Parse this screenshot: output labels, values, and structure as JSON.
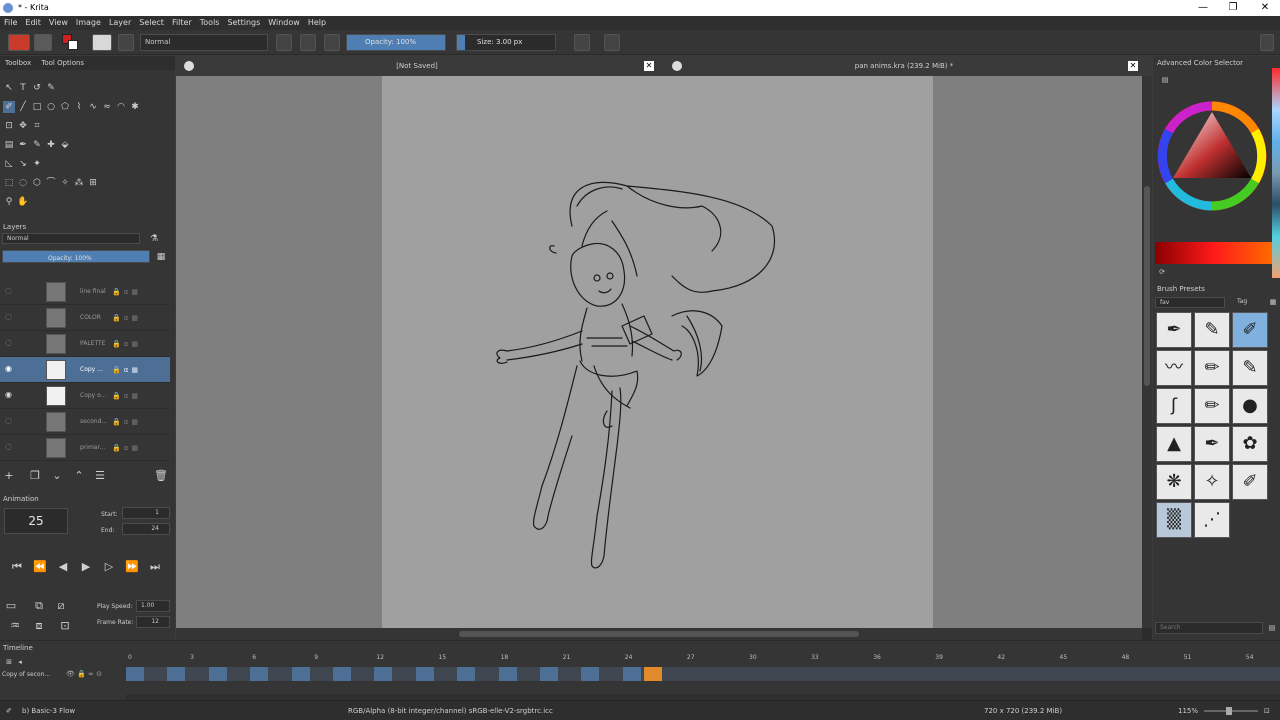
{
  "window": {
    "title": "* - Krita"
  },
  "menu": [
    "File",
    "Edit",
    "View",
    "Image",
    "Layer",
    "Select",
    "Filter",
    "Tools",
    "Settings",
    "Window",
    "Help"
  ],
  "toolbar": {
    "blend_mode": "Normal",
    "opacity_label": "Opacity: 100%",
    "opacity_value": 1.0,
    "size_label": "Size: 3.00 px"
  },
  "left_tabs": [
    "Toolbox",
    "Tool Options"
  ],
  "layers": {
    "title": "Layers",
    "blend_mode": "Normal",
    "opacity_label": "Opacity: 100%",
    "items": [
      {
        "name": "line final",
        "visible": false,
        "selected": false
      },
      {
        "name": "COLOR",
        "visible": false,
        "selected": false
      },
      {
        "name": "PALETTE",
        "visible": false,
        "selected": false
      },
      {
        "name": "Copy ...",
        "visible": true,
        "selected": true
      },
      {
        "name": "Copy o...",
        "visible": true,
        "selected": false
      },
      {
        "name": "second...",
        "visible": false,
        "selected": false
      },
      {
        "name": "primar...",
        "visible": false,
        "selected": false
      }
    ]
  },
  "animation": {
    "title": "Animation",
    "current_frame": "25",
    "start_label": "Start:",
    "start_value": "1",
    "end_label": "End:",
    "end_value": "24",
    "play_speed_label": "Play Speed:",
    "play_speed_value": "1.00",
    "frame_rate_label": "Frame Rate:",
    "frame_rate_value": "12"
  },
  "documents": [
    {
      "label": "[Not Saved]"
    },
    {
      "label": "pan anims.kra (239.2 MiB) *"
    }
  ],
  "right": {
    "color_selector_title": "Advanced Color Selector",
    "brush_presets_title": "Brush Presets",
    "brush_tag": "fav",
    "tag_label": "Tag",
    "search_placeholder": "Search"
  },
  "timeline": {
    "title": "Timeline",
    "layer_name": "Copy of secon...",
    "ticks": [
      "0",
      "3",
      "6",
      "9",
      "12",
      "15",
      "18",
      "21",
      "24",
      "27",
      "30",
      "33",
      "36",
      "39",
      "42",
      "45",
      "48",
      "51",
      "54"
    ],
    "current_frame": 25
  },
  "status": {
    "brush": "b) Basic-3 Flow",
    "colorspace": "RGB/Alpha (8-bit integer/channel)  sRGB-elle-V2-srgbtrc.icc",
    "dims": "720 x 720 (239.2 MiB)",
    "zoom": "115%"
  },
  "colors": {
    "accent": "#4e6f95",
    "current_frame": "#e08a2c",
    "foreground": "#d02020",
    "background": "#ffffff"
  }
}
